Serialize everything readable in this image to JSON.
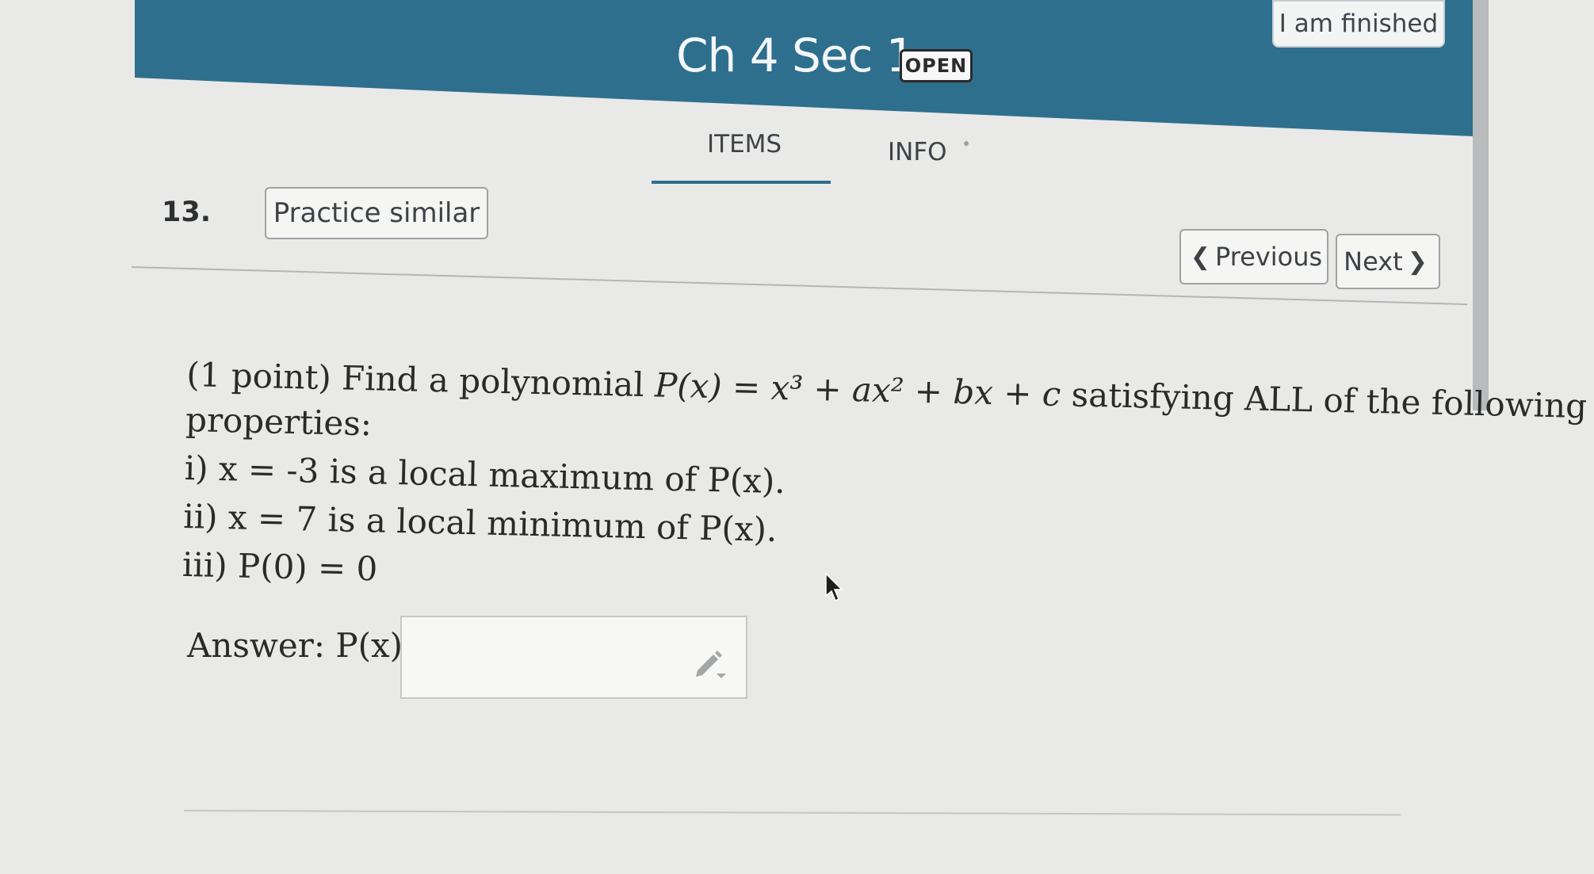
{
  "header": {
    "title": "Ch 4 Sec 1",
    "status_badge": "OPEN",
    "finish_button": "I am finished"
  },
  "tabs": [
    {
      "label": "ITEMS",
      "active": true
    },
    {
      "label": "INFO",
      "active": false
    }
  ],
  "question": {
    "number": "13.",
    "practice_button": "Practice similar",
    "nav": {
      "previous": "Previous",
      "next": "Next"
    },
    "prompt": {
      "intro": "(1 point) Find a polynomial ",
      "formula": "P(x) = x³ + ax² + bx + c",
      "outro": " satisfying ALL of the following",
      "continuation": "properties:"
    },
    "properties": [
      "i) x = -3 is a local maximum of P(x).",
      "ii) x = 7 is a local minimum of P(x).",
      "iii) P(0) = 0"
    ],
    "answer_label": "Answer: P(x)=",
    "answer_value": ""
  },
  "colors": {
    "header": "#2f6f8e",
    "background": "#e9e9e7",
    "text": "#2a2a2a"
  },
  "icons": [
    "pencil-icon",
    "chevron-left-icon",
    "chevron-right-icon",
    "mouse-cursor-icon"
  ]
}
